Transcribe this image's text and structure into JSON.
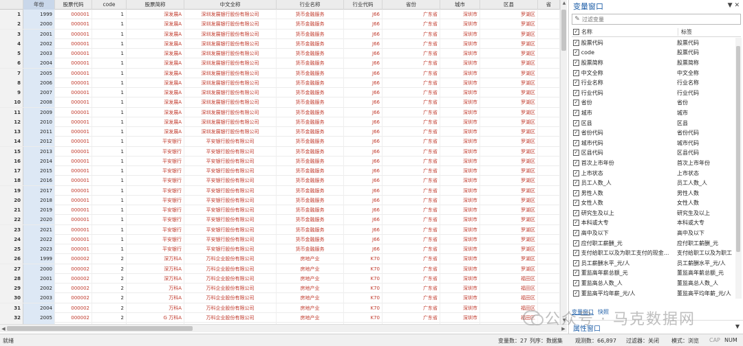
{
  "grid": {
    "columns": [
      "年份",
      "股票代码",
      "code",
      "股票简称",
      "中文全称",
      "行业名称",
      "行业代码",
      "省份",
      "城市",
      "区县",
      "省"
    ],
    "rows": [
      [
        "1",
        "1999",
        "000001",
        "1",
        "深发展A",
        "深圳发展银行股份有限公司",
        "货币金融服务",
        "J66",
        "广东省",
        "深圳市",
        "罗湖区"
      ],
      [
        "2",
        "2000",
        "000001",
        "1",
        "深发展A",
        "深圳发展银行股份有限公司",
        "货币金融服务",
        "J66",
        "广东省",
        "深圳市",
        "罗湖区"
      ],
      [
        "3",
        "2001",
        "000001",
        "1",
        "深发展A",
        "深圳发展银行股份有限公司",
        "货币金融服务",
        "J66",
        "广东省",
        "深圳市",
        "罗湖区"
      ],
      [
        "4",
        "2002",
        "000001",
        "1",
        "深发展A",
        "深圳发展银行股份有限公司",
        "货币金融服务",
        "J66",
        "广东省",
        "深圳市",
        "罗湖区"
      ],
      [
        "5",
        "2003",
        "000001",
        "1",
        "深发展A",
        "深圳发展银行股份有限公司",
        "货币金融服务",
        "J66",
        "广东省",
        "深圳市",
        "罗湖区"
      ],
      [
        "6",
        "2004",
        "000001",
        "1",
        "深发展A",
        "深圳发展银行股份有限公司",
        "货币金融服务",
        "J66",
        "广东省",
        "深圳市",
        "罗湖区"
      ],
      [
        "7",
        "2005",
        "000001",
        "1",
        "深发展A",
        "深圳发展银行股份有限公司",
        "货币金融服务",
        "J66",
        "广东省",
        "深圳市",
        "罗湖区"
      ],
      [
        "8",
        "2006",
        "000001",
        "1",
        "深发展A",
        "深圳发展银行股份有限公司",
        "货币金融服务",
        "J66",
        "广东省",
        "深圳市",
        "罗湖区"
      ],
      [
        "9",
        "2007",
        "000001",
        "1",
        "深发展A",
        "深圳发展银行股份有限公司",
        "货币金融服务",
        "J66",
        "广东省",
        "深圳市",
        "罗湖区"
      ],
      [
        "10",
        "2008",
        "000001",
        "1",
        "深发展A",
        "深圳发展银行股份有限公司",
        "货币金融服务",
        "J66",
        "广东省",
        "深圳市",
        "罗湖区"
      ],
      [
        "11",
        "2009",
        "000001",
        "1",
        "深发展A",
        "深圳发展银行股份有限公司",
        "货币金融服务",
        "J66",
        "广东省",
        "深圳市",
        "罗湖区"
      ],
      [
        "12",
        "2010",
        "000001",
        "1",
        "深发展A",
        "深圳发展银行股份有限公司",
        "货币金融服务",
        "J66",
        "广东省",
        "深圳市",
        "罗湖区"
      ],
      [
        "13",
        "2011",
        "000001",
        "1",
        "深发展A",
        "深圳发展银行股份有限公司",
        "货币金融服务",
        "J66",
        "广东省",
        "深圳市",
        "罗湖区"
      ],
      [
        "14",
        "2012",
        "000001",
        "1",
        "平安银行",
        "平安银行股份有限公司",
        "货币金融服务",
        "J66",
        "广东省",
        "深圳市",
        "罗湖区"
      ],
      [
        "15",
        "2013",
        "000001",
        "1",
        "平安银行",
        "平安银行股份有限公司",
        "货币金融服务",
        "J66",
        "广东省",
        "深圳市",
        "罗湖区"
      ],
      [
        "16",
        "2014",
        "000001",
        "1",
        "平安银行",
        "平安银行股份有限公司",
        "货币金融服务",
        "J66",
        "广东省",
        "深圳市",
        "罗湖区"
      ],
      [
        "17",
        "2015",
        "000001",
        "1",
        "平安银行",
        "平安银行股份有限公司",
        "货币金融服务",
        "J66",
        "广东省",
        "深圳市",
        "罗湖区"
      ],
      [
        "18",
        "2016",
        "000001",
        "1",
        "平安银行",
        "平安银行股份有限公司",
        "货币金融服务",
        "J66",
        "广东省",
        "深圳市",
        "罗湖区"
      ],
      [
        "19",
        "2017",
        "000001",
        "1",
        "平安银行",
        "平安银行股份有限公司",
        "货币金融服务",
        "J66",
        "广东省",
        "深圳市",
        "罗湖区"
      ],
      [
        "20",
        "2018",
        "000001",
        "1",
        "平安银行",
        "平安银行股份有限公司",
        "货币金融服务",
        "J66",
        "广东省",
        "深圳市",
        "罗湖区"
      ],
      [
        "21",
        "2019",
        "000001",
        "1",
        "平安银行",
        "平安银行股份有限公司",
        "货币金融服务",
        "J66",
        "广东省",
        "深圳市",
        "罗湖区"
      ],
      [
        "22",
        "2020",
        "000001",
        "1",
        "平安银行",
        "平安银行股份有限公司",
        "货币金融服务",
        "J66",
        "广东省",
        "深圳市",
        "罗湖区"
      ],
      [
        "23",
        "2021",
        "000001",
        "1",
        "平安银行",
        "平安银行股份有限公司",
        "货币金融服务",
        "J66",
        "广东省",
        "深圳市",
        "罗湖区"
      ],
      [
        "24",
        "2022",
        "000001",
        "1",
        "平安银行",
        "平安银行股份有限公司",
        "货币金融服务",
        "J66",
        "广东省",
        "深圳市",
        "罗湖区"
      ],
      [
        "25",
        "2023",
        "000001",
        "1",
        "平安银行",
        "平安银行股份有限公司",
        "货币金融服务",
        "J66",
        "广东省",
        "深圳市",
        "罗湖区"
      ],
      [
        "26",
        "1999",
        "000002",
        "2",
        "深万科A",
        "万科企业股份有限公司",
        "房地产业",
        "K70",
        "广东省",
        "深圳市",
        "罗湖区"
      ],
      [
        "27",
        "2000",
        "000002",
        "2",
        "深万科A",
        "万科企业股份有限公司",
        "房地产业",
        "K70",
        "广东省",
        "深圳市",
        "罗湖区"
      ],
      [
        "28",
        "2001",
        "000002",
        "2",
        "深万科A",
        "万科企业股份有限公司",
        "房地产业",
        "K70",
        "广东省",
        "深圳市",
        "福田区"
      ],
      [
        "29",
        "2002",
        "000002",
        "2",
        "万科A",
        "万科企业股份有限公司",
        "房地产业",
        "K70",
        "广东省",
        "深圳市",
        "福田区"
      ],
      [
        "30",
        "2003",
        "000002",
        "2",
        "万科A",
        "万科企业股份有限公司",
        "房地产业",
        "K70",
        "广东省",
        "深圳市",
        "福田区"
      ],
      [
        "31",
        "2004",
        "000002",
        "2",
        "万科A",
        "万科企业股份有限公司",
        "房地产业",
        "K70",
        "广东省",
        "深圳市",
        "福田区"
      ],
      [
        "32",
        "2005",
        "000002",
        "2",
        "G 万科A",
        "万科企业股份有限公司",
        "房地产业",
        "K70",
        "广东省",
        "深圳市",
        "福田区"
      ],
      [
        "33",
        "2006",
        "000002",
        "2",
        "万科A",
        "万科企业股份有限公司",
        "房地产业",
        "K70",
        "广东省",
        "深圳市",
        "福田区"
      ]
    ]
  },
  "panel": {
    "title": "变量窗口",
    "pin": "▼ ✕",
    "filter_placeholder": "过滤变量",
    "col_name": "名称",
    "col_label": "标签",
    "variables": [
      [
        "股票代码",
        "股票代码"
      ],
      [
        "code",
        "股票代码"
      ],
      [
        "股票简称",
        "股票简称"
      ],
      [
        "中文全称",
        "中文全称"
      ],
      [
        "行业名称",
        "行业名称"
      ],
      [
        "行业代码",
        "行业代码"
      ],
      [
        "省份",
        "省份"
      ],
      [
        "城市",
        "城市"
      ],
      [
        "区县",
        "区县"
      ],
      [
        "省份代码",
        "省份代码"
      ],
      [
        "城市代码",
        "城市代码"
      ],
      [
        "区县代码",
        "区县代码"
      ],
      [
        "首次上市年份",
        "首次上市年份"
      ],
      [
        "上市状态",
        "上市状态"
      ],
      [
        "员工人数_人",
        "员工人数_人"
      ],
      [
        "男性人数",
        "男性人数"
      ],
      [
        "女性人数",
        "女性人数"
      ],
      [
        "研究生及以上",
        "研究生及以上"
      ],
      [
        "本科或大专",
        "本科或大专"
      ],
      [
        "高中及以下",
        "高中及以下"
      ],
      [
        "应付职工薪酬_元",
        "应付职工薪酬_元"
      ],
      [
        "支付给职工以及为职工支付的现金...",
        "支付给职工以及为职工"
      ],
      [
        "员工薪酬水平_元/人",
        "员工薪酬水平_元/人"
      ],
      [
        "董监高年薪总额_元",
        "董监高年薪总额_元"
      ],
      [
        "董监高总人数_人",
        "董监高总人数_人"
      ],
      [
        "董监高平均年薪_元/人",
        "董监高平均年薪_元/人"
      ]
    ],
    "tabs": [
      "变量窗口",
      "快照"
    ],
    "prop_title": "属性窗口",
    "prop_pin": "▼"
  },
  "watermark": "公众号 · 马克数据网",
  "status": {
    "ready": "就绪",
    "vars": "变量数：27",
    "order": "列序：数据集",
    "obs": "观测数：66,897",
    "filter": "过滤器：关闭",
    "mode": "模式：浏览",
    "cap": "CAP",
    "num": "NUM"
  }
}
